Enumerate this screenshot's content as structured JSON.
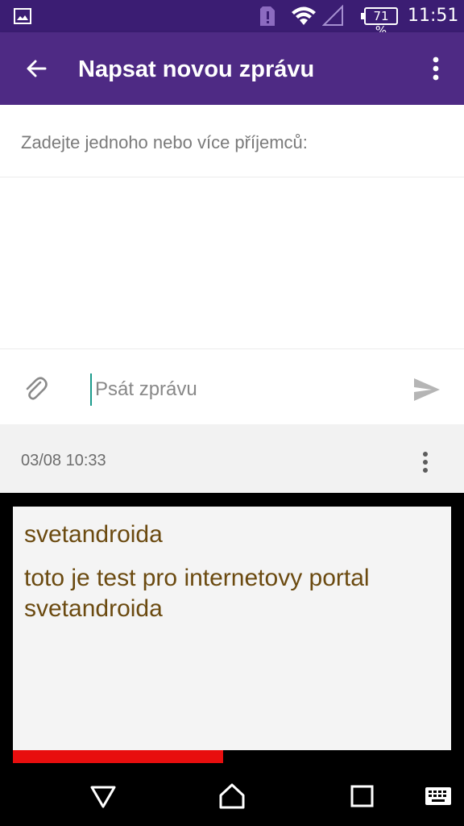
{
  "status_bar": {
    "battery_percent": "71 %",
    "time": "11:51",
    "icons": [
      "image-notification-icon",
      "sim-alert-icon",
      "wifi-icon",
      "signal-icon",
      "battery-icon"
    ]
  },
  "toolbar": {
    "title": "Napsat novou zprávu",
    "icons": [
      "back-arrow-icon",
      "more-vertical-icon"
    ]
  },
  "recipients": {
    "placeholder": "Zadejte jednoho nebo více příjemců:"
  },
  "composer": {
    "placeholder": "Psát zprávu",
    "icons": [
      "attach-icon",
      "send-icon"
    ]
  },
  "message_info": {
    "timestamp": "03/08 10:33"
  },
  "preview": {
    "sender": "svetandroida",
    "body": "toto je test pro internetovy portal svetandroida",
    "progress": 0.48
  },
  "colors": {
    "status_bar": "#3b1d73",
    "toolbar": "#4e2a84",
    "cursor": "#1c9b8c",
    "preview_text": "#6b4a10",
    "progress": "#e80e0e"
  },
  "navbar": {
    "icons": [
      "back-triangle-icon",
      "home-icon",
      "recents-icon",
      "keyboard-icon"
    ]
  }
}
